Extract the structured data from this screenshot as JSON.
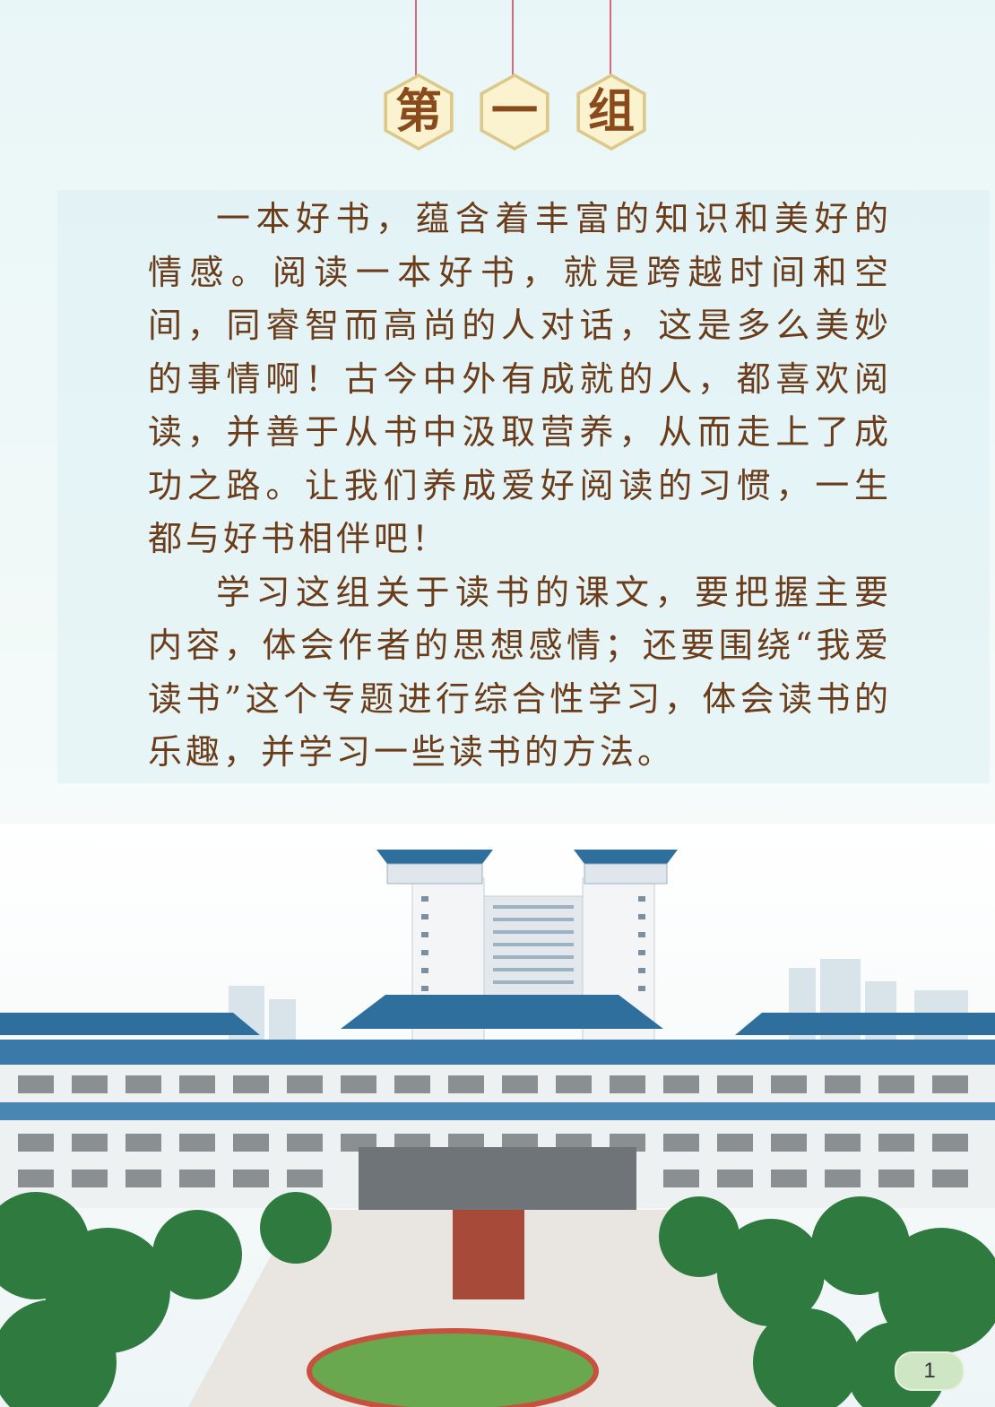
{
  "title": {
    "chars": [
      "第",
      "一",
      "组"
    ]
  },
  "intro": {
    "paragraphs": [
      "一本好书，蕴含着丰富的知识和美好的情感。阅读一本好书，就是跨越时间和空间，同睿智而高尚的人对话，这是多么美妙的事情啊！古今中外有成就的人，都喜欢阅读，并善于从书中汲取营养，从而走上了成功之路。让我们养成爱好阅读的习惯，一生都与好书相伴吧！",
      "学习这组关于读书的课文，要把握主要内容，体会作者的思想感情；还要围绕“我爱读书”这个专题进行综合性学习，体会读书的乐趣，并学习一些读书的方法。"
    ]
  },
  "page_number": "1",
  "colors": {
    "text": "#6b3c1a",
    "title_text": "#8a4b1c",
    "hex_fill": "#fbf3cf",
    "string": "#d66a7c",
    "roof_blue": "#2f6f9e"
  }
}
